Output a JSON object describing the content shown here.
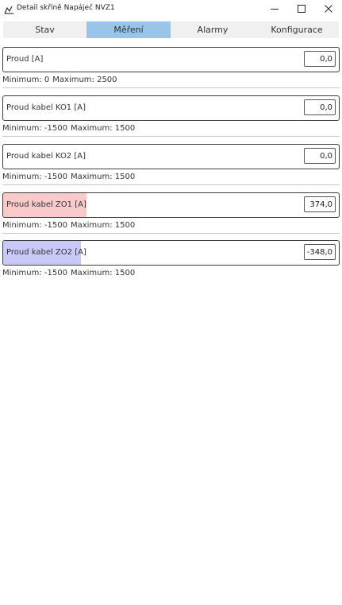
{
  "window": {
    "title": "Detail skříně Napáječ NVZ1",
    "icon": "cabinet-icon",
    "controls": [
      "minimize-icon",
      "maximize-icon",
      "close-icon"
    ]
  },
  "tabs": [
    {
      "label": "Stav",
      "active": false
    },
    {
      "label": "Měření",
      "active": true
    },
    {
      "label": "Alarmy",
      "active": false
    },
    {
      "label": "Konfigurace",
      "active": false
    }
  ],
  "colors": {
    "active_tab": "#99c5ea",
    "positive_fill": "#f9caca",
    "negative_fill": "#c9c9f7"
  },
  "measurements": [
    {
      "label": "Proud [A]",
      "value": "0,0",
      "min_text": "Minimum: 0",
      "max_text": "Maximum: 2500",
      "level": 0.0,
      "fill_color": "#f9caca"
    },
    {
      "label": "Proud kabel KO1 [A]",
      "value": "0,0",
      "min_text": "Minimum: -1500",
      "max_text": "Maximum: 1500",
      "level": 0.0,
      "fill_color": "#f9caca"
    },
    {
      "label": "Proud kabel KO2 [A]",
      "value": "0,0",
      "min_text": "Minimum: -1500",
      "max_text": "Maximum: 1500",
      "level": 0.0,
      "fill_color": "#f9caca"
    },
    {
      "label": "Proud kabel ZO1 [A]",
      "value": "374,0",
      "min_text": "Minimum: -1500",
      "max_text": "Maximum: 1500",
      "level": 0.249,
      "fill_color": "#f9caca"
    },
    {
      "label": "Proud kabel ZO2 [A]",
      "value": "-348,0",
      "min_text": "Minimum: -1500",
      "max_text": "Maximum: 1500",
      "level": 0.232,
      "fill_color": "#c9c9f7"
    }
  ]
}
